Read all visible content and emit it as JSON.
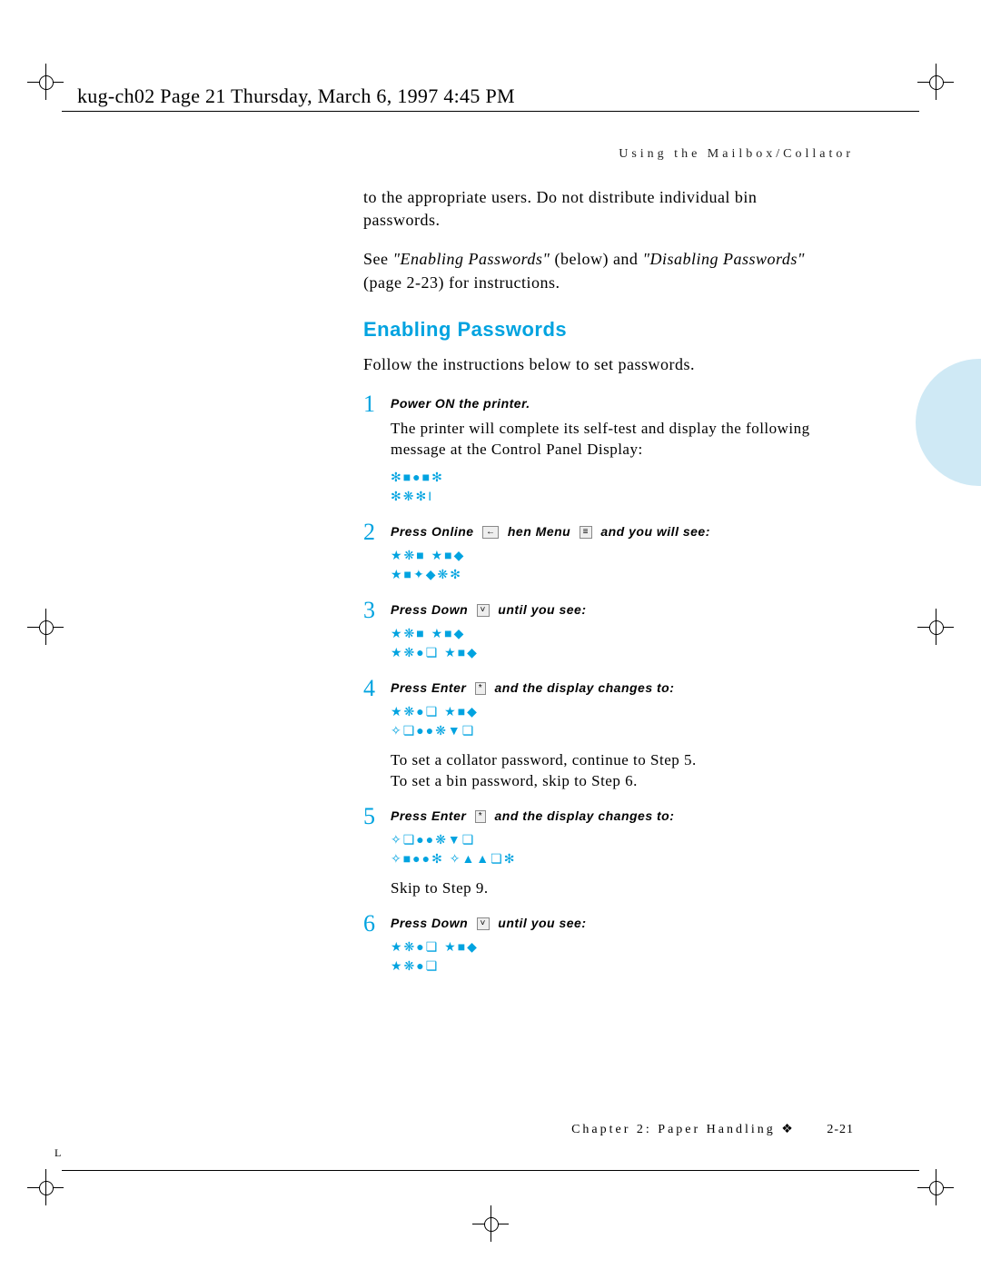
{
  "header": "kug-ch02  Page 21  Thursday, March 6, 1997  4:45 PM",
  "running_head": "Using the Mailbox/Collator",
  "intro_para": "to the appropriate users. Do not distribute individual bin passwords.",
  "see_line": {
    "prefix": "See ",
    "ref1": "\"Enabling Passwords\"",
    "mid1": " (below) and ",
    "ref2": "\"Disabling Passwords\"",
    "mid2": " (page 2-23) for instructions."
  },
  "section_title": "Enabling Passwords",
  "section_intro": "Follow the instructions below to set passwords.",
  "steps": [
    {
      "num": "1",
      "title": "Power ON the printer.",
      "body": "The printer will complete its self-test and display the following message at the Control Panel Display:",
      "display": "✻■●■✻\n✻❋✻I"
    },
    {
      "num": "2",
      "title_parts": [
        "Press Online ",
        "←",
        " hen Menu ",
        "≡",
        " and you will see:"
      ],
      "display": "★❋■ ★■◆\n★■✦◆❋✻"
    },
    {
      "num": "3",
      "title_parts": [
        "Press Down ",
        "˅",
        " until you see:"
      ],
      "display": "★❋■ ★■◆\n★❋●❏ ★■◆"
    },
    {
      "num": "4",
      "title_parts": [
        "Press Enter ",
        "*",
        " and the display changes to:"
      ],
      "display": "★❋●❏ ★■◆\n✧❏●●❋▼❏",
      "after": "To set a collator password, continue to Step 5.\nTo set a bin password, skip to Step 6."
    },
    {
      "num": "5",
      "title_parts": [
        "Press Enter ",
        "*",
        " and the display changes to:"
      ],
      "display": "✧❏●●❋▼❏\n✧■●●✻ ✧▲▲❏✻",
      "after": "Skip to Step 9."
    },
    {
      "num": "6",
      "title_parts": [
        "Press Down ",
        "˅",
        " until you see:"
      ],
      "display": "★❋●❏ ★■◆\n★❋●❏"
    }
  ],
  "footer": {
    "chapter": "Chapter 2: Paper Handling",
    "arrow": "❖",
    "pagenum": "2-21"
  },
  "side_letter": "L"
}
